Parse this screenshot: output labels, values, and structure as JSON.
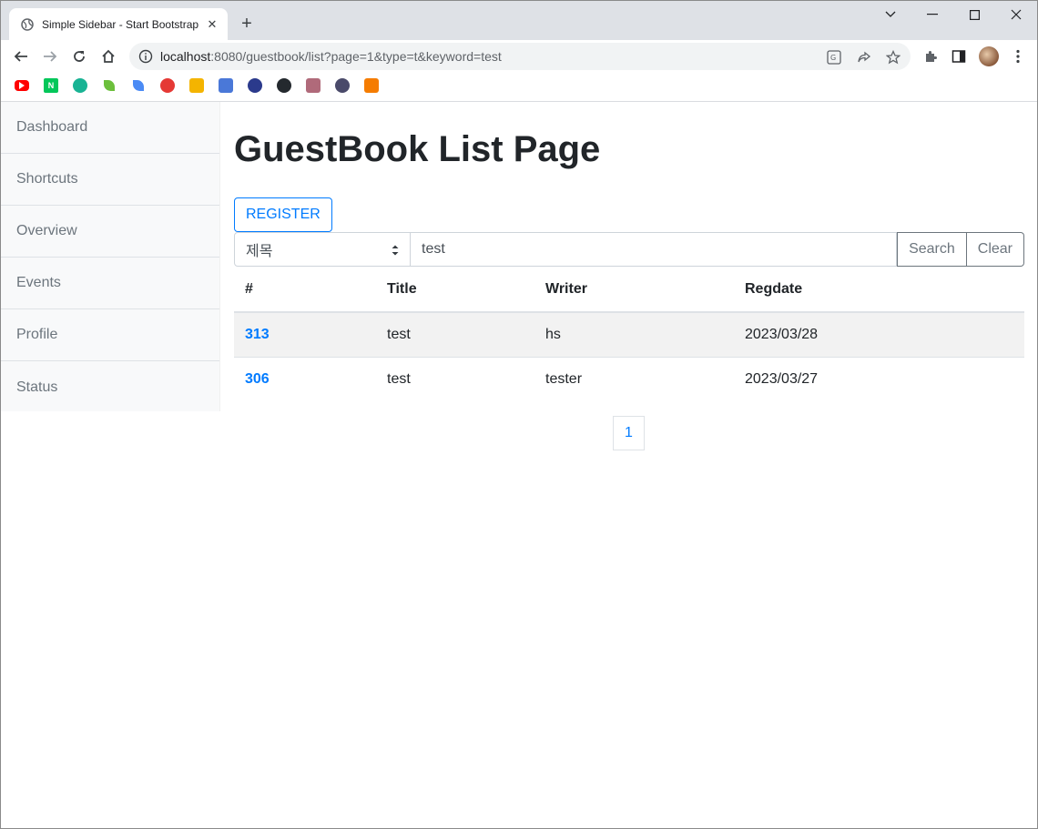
{
  "browser": {
    "tab_title": "Simple Sidebar - Start Bootstrap",
    "url_host": "localhost",
    "url_rest": ":8080/guestbook/list?page=1&type=t&keyword=test",
    "bookmarks": [
      {
        "icon": "youtube-icon",
        "color": "#ff0000"
      },
      {
        "icon": "naver-icon",
        "color": "#03c75a",
        "letter": "N"
      },
      {
        "icon": "circle-green-icon",
        "color": "#19b394"
      },
      {
        "icon": "leaf-icon",
        "color": "#6cbf3c"
      },
      {
        "icon": "feather-icon",
        "color": "#4b8bf5"
      },
      {
        "icon": "lifebuoy-icon",
        "color": "#e53935"
      },
      {
        "icon": "classroom-icon",
        "color": "#f4b400"
      },
      {
        "icon": "bank-icon",
        "color": "#4a78d8"
      },
      {
        "icon": "owl-icon",
        "color": "#2b3a8c"
      },
      {
        "icon": "github-icon",
        "color": "#24292e"
      },
      {
        "icon": "photo-icon",
        "color": "#b06a7a"
      },
      {
        "icon": "avatar-icon",
        "color": "#4a4a6a"
      },
      {
        "icon": "cube-icon",
        "color": "#f57c00"
      }
    ]
  },
  "sidebar": {
    "items": [
      {
        "label": "Dashboard"
      },
      {
        "label": "Shortcuts"
      },
      {
        "label": "Overview"
      },
      {
        "label": "Events"
      },
      {
        "label": "Profile"
      },
      {
        "label": "Status"
      }
    ]
  },
  "main": {
    "title": "GuestBook List Page",
    "register_label": "REGISTER",
    "search": {
      "type_selected": "제목",
      "keyword": "test",
      "search_label": "Search",
      "clear_label": "Clear"
    },
    "table": {
      "headers": [
        "#",
        "Title",
        "Writer",
        "Regdate"
      ],
      "rows": [
        {
          "gno": "313",
          "title": "test",
          "writer": "hs",
          "regdate": "2023/03/28"
        },
        {
          "gno": "306",
          "title": "test",
          "writer": "tester",
          "regdate": "2023/03/27"
        }
      ]
    },
    "pagination": {
      "current": "1"
    }
  },
  "colors": {
    "primary": "#007bff",
    "secondary": "#6c757d"
  }
}
